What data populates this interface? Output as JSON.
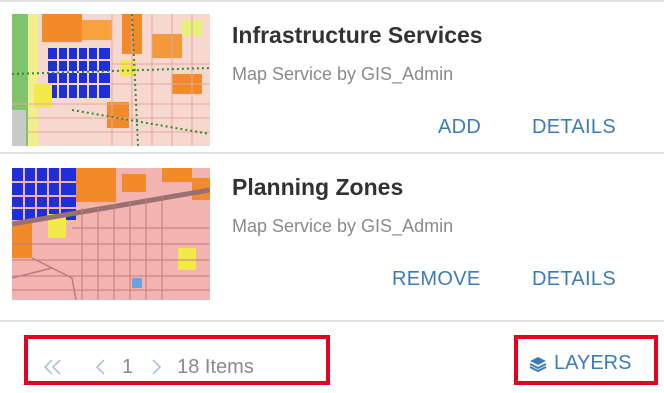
{
  "items": [
    {
      "title": "Infrastructure Services",
      "subtitle": "Map Service by GIS_Admin",
      "primary_action": "ADD",
      "secondary_action": "DETAILS"
    },
    {
      "title": "Planning Zones",
      "subtitle": "Map Service by GIS_Admin",
      "primary_action": "REMOVE",
      "secondary_action": "DETAILS"
    }
  ],
  "pager": {
    "first_icon": "double-chevron-left-icon",
    "prev_icon": "chevron-left-icon",
    "page": "1",
    "next_icon": "chevron-right-icon",
    "count_label": "18 Items"
  },
  "layers": {
    "icon": "layers-icon",
    "label": "LAYERS"
  },
  "colors": {
    "accent": "#3b7cb8",
    "highlight_border": "#e6001d",
    "muted_text": "#8a8a8a"
  }
}
